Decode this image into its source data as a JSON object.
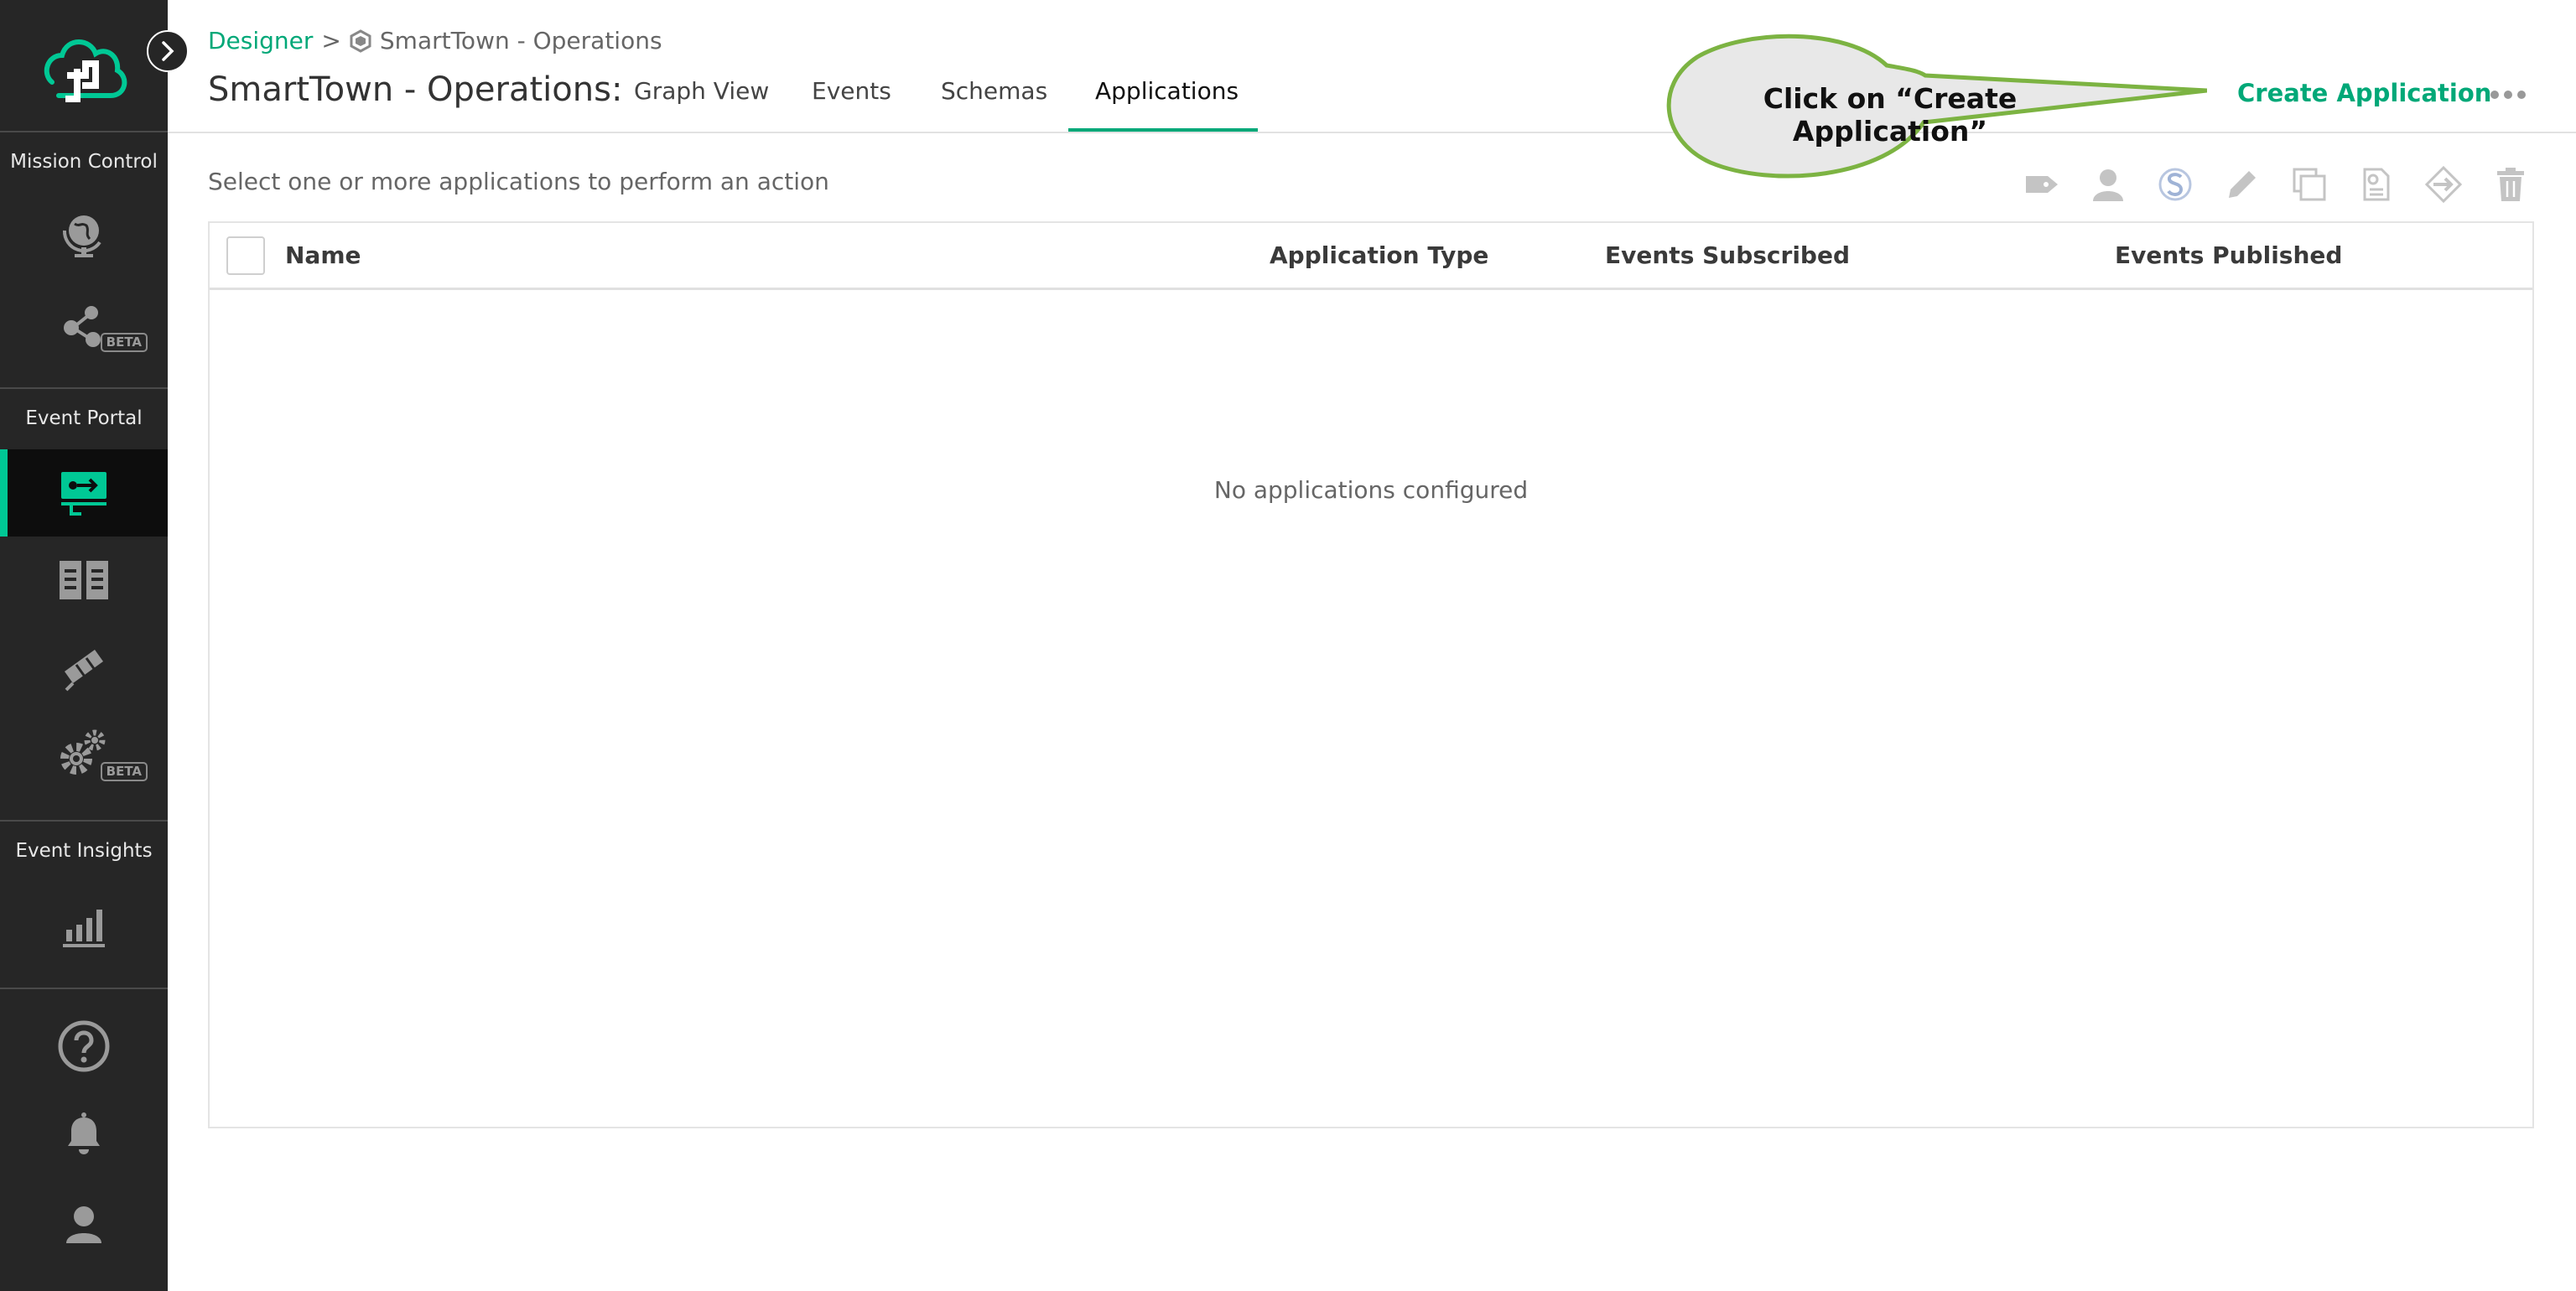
{
  "sidebar": {
    "sections": [
      {
        "label": "Mission Control"
      },
      {
        "label": "Event Portal"
      },
      {
        "label": "Event Insights"
      }
    ],
    "badges": {
      "beta": "BETA"
    },
    "icons": [
      "logo-cloud-icon",
      "globe-icon",
      "graph-nodes-icon",
      "designer-icon",
      "catalog-book-icon",
      "telescope-icon",
      "gear-icon",
      "bar-chart-icon",
      "help-icon",
      "bell-icon",
      "user-icon"
    ],
    "colors": {
      "background": "#262626",
      "active_indicator": "#00c895"
    }
  },
  "breadcrumb": {
    "root": "Designer",
    "separator": ">",
    "current": "SmartTown - Operations"
  },
  "header": {
    "title": "SmartTown - Operations:",
    "tabs": [
      {
        "label": "Graph View"
      },
      {
        "label": "Events"
      },
      {
        "label": "Schemas"
      },
      {
        "label": "Applications",
        "active": true
      }
    ],
    "create_label": "Create Application",
    "accent": "#00a878"
  },
  "callout": {
    "text": "Click on “Create Application”",
    "border": "#7cb342"
  },
  "main": {
    "hint": "Select one or more applications to perform an action",
    "action_icons": [
      "tag-icon",
      "owner-icon",
      "shared-icon",
      "edit-icon",
      "duplicate-icon",
      "copy-doc-icon",
      "move-icon",
      "delete-icon"
    ],
    "table": {
      "columns": [
        "Name",
        "Application Type",
        "Events Subscribed",
        "Events Published"
      ],
      "rows": [],
      "empty_message": "No applications configured"
    }
  }
}
